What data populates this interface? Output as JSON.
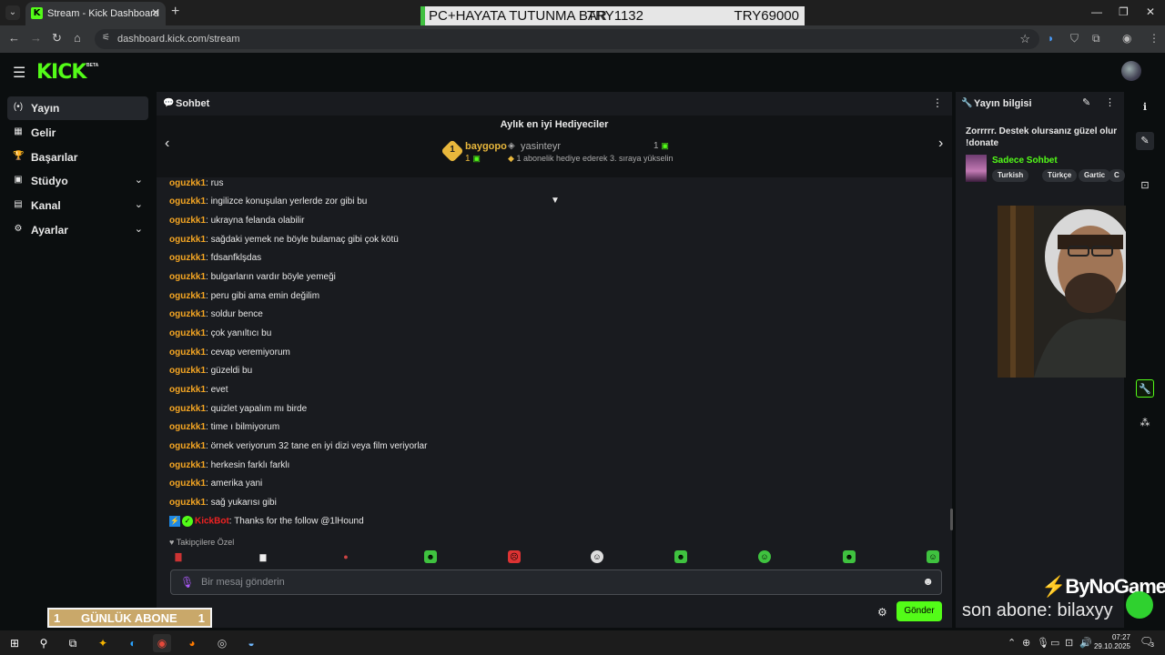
{
  "browser": {
    "tab_title": "Stream - Kick Dashboard",
    "url": "dashboard.kick.com/stream"
  },
  "overlay_banner": {
    "text": "PC+HAYATA TUTUNMA BAR",
    "mid": "TRY1132",
    "right": "TRY69000"
  },
  "kick": {
    "logo": "KICK",
    "beta": "BETA"
  },
  "sidebar": {
    "items": [
      {
        "label": "Yayın",
        "icon": "broadcast-icon",
        "glyph": "(•)",
        "active": true,
        "expandable": false
      },
      {
        "label": "Gelir",
        "icon": "revenue-icon",
        "glyph": "▦",
        "active": false,
        "expandable": false
      },
      {
        "label": "Başarılar",
        "icon": "trophy-icon",
        "glyph": "🏆",
        "active": false,
        "expandable": false
      },
      {
        "label": "Stüdyo",
        "icon": "studio-icon",
        "glyph": "▣",
        "active": false,
        "expandable": true
      },
      {
        "label": "Kanal",
        "icon": "channel-icon",
        "glyph": "▤",
        "active": false,
        "expandable": true
      },
      {
        "label": "Ayarlar",
        "icon": "gear-icon",
        "glyph": "⚙",
        "active": false,
        "expandable": true
      }
    ]
  },
  "chat": {
    "title": "Sohbet",
    "gifters_title": "Aylık en iyi Hediyeciler",
    "top_gifter": {
      "rank": "1",
      "name": "baygopo",
      "count": "1"
    },
    "second_gifter": {
      "name": "yasinteyr",
      "count": "1",
      "note": "1 abonelik hediye ederek 3. sıraya yükselin"
    },
    "messages": [
      {
        "user": "oguzkk1",
        "text": "rus"
      },
      {
        "user": "oguzkk1",
        "text": "ingilizce konuşulan yerlerde zor gibi bu"
      },
      {
        "user": "oguzkk1",
        "text": "ukrayna felanda olabilir"
      },
      {
        "user": "oguzkk1",
        "text": "sağdaki yemek ne böyle bulamaç gibi çok kötü"
      },
      {
        "user": "oguzkk1",
        "text": "fdsanfklşdas"
      },
      {
        "user": "oguzkk1",
        "text": "bulgarların vardır böyle yemeği"
      },
      {
        "user": "oguzkk1",
        "text": "peru gibi ama emin değilim"
      },
      {
        "user": "oguzkk1",
        "text": "soldur bence"
      },
      {
        "user": "oguzkk1",
        "text": "çok yanıltıcı bu"
      },
      {
        "user": "oguzkk1",
        "text": "cevap veremiyorum"
      },
      {
        "user": "oguzkk1",
        "text": "güzeldi bu"
      },
      {
        "user": "oguzkk1",
        "text": "evet"
      },
      {
        "user": "oguzkk1",
        "text": "quizlet yapalım mı birde"
      },
      {
        "user": "oguzkk1",
        "text": "time ı bilmiyorum"
      },
      {
        "user": "oguzkk1",
        "text": "örnek veriyorum 32 tane en iyi dizi veya film veriyorlar"
      },
      {
        "user": "oguzkk1",
        "text": "herkesin farklı farklı"
      },
      {
        "user": "oguzkk1",
        "text": "amerika yani"
      },
      {
        "user": "oguzkk1",
        "text": "sağ yukarısı gibi"
      }
    ],
    "bot_message": {
      "user": "KickBot",
      "text": "Thanks for the follow @1lHound"
    },
    "emote_label": "Takipçilere Özel",
    "input_placeholder": "Bir mesaj gönderin",
    "send_label": "Gönder"
  },
  "stream_info": {
    "title": "Yayın bilgisi",
    "stream_title": "Zorrrrr. Destek olursanız güzel olur !donate",
    "category": "Sadece Sohbet",
    "tags": [
      "Turkish",
      "Türkçe",
      "Gartic",
      "C"
    ]
  },
  "overlays": {
    "daily_sub_count": "1",
    "daily_sub_label": "GÜNLÜK ABONE",
    "daily_sub_count2": "1",
    "brand": "ByNoGame",
    "last_sub": "son abone: bilaxyy"
  },
  "taskbar": {
    "time": "07:27",
    "date": "29.10.2025",
    "notif_count": "3"
  }
}
